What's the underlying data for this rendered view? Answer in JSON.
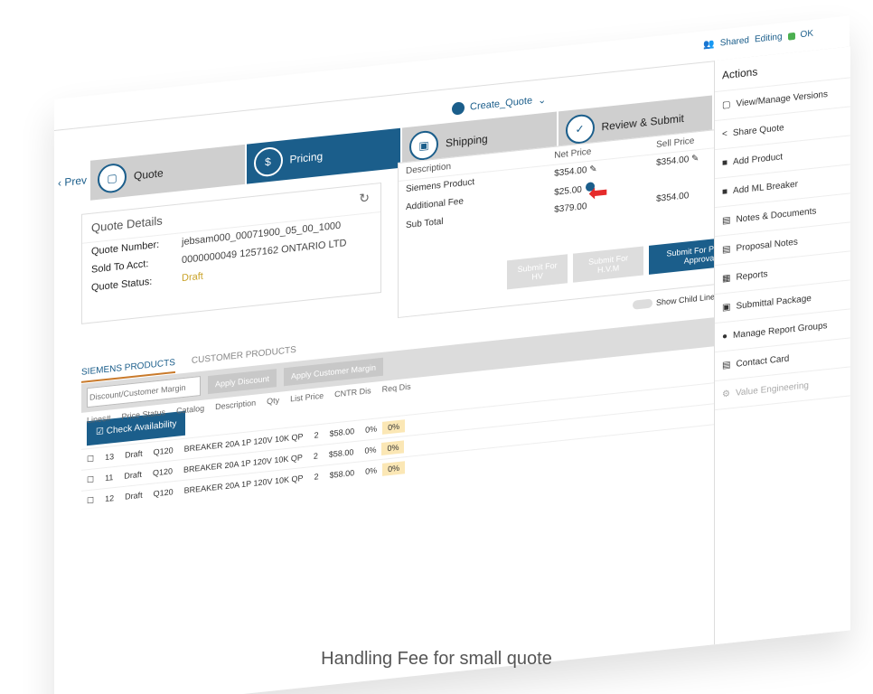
{
  "topbar": {
    "mode": "Shared",
    "editing": "Editing",
    "status_badge": "OK"
  },
  "quote_chip": "Create_Quote",
  "stepper": [
    {
      "label": "Quote",
      "icon": "document-icon"
    },
    {
      "label": "Pricing",
      "icon": "dollar-icon"
    },
    {
      "label": "Shipping",
      "icon": "box-icon"
    },
    {
      "label": "Review & Submit",
      "icon": "check-icon"
    }
  ],
  "prev": "Prev",
  "quote_details": {
    "title": "Quote Details",
    "quote_number_label": "Quote Number:",
    "quote_number": "jebsam000_00071900_05_00_1000",
    "sold_to_label": "Sold To Acct:",
    "sold_to": "0000000049 1257162 ONTARIO LTD",
    "status_label": "Quote Status:",
    "status": "Draft"
  },
  "pricing_summary": {
    "headers": [
      "Description",
      "Net Price",
      "Sell Price"
    ],
    "rows": [
      {
        "desc": "Siemens Product",
        "net": "$354.00",
        "sell": "$354.00"
      },
      {
        "desc": "Additional Fee",
        "net": "$25.00",
        "sell": ""
      },
      {
        "desc": "Sub Total",
        "net": "$379.00",
        "sell": "$354.00"
      }
    ],
    "buttons": [
      "Submit For HV",
      "Submit For H.V.M",
      "Submit For Pricing Approval"
    ]
  },
  "tabs": [
    "SIEMENS PRODUCTS",
    "CUSTOMER PRODUCTS"
  ],
  "show_child_lines": "Show Child Lines",
  "toolbar": {
    "input_placeholder": "Discount/Customer Margin",
    "apply_discount": "Apply Discount",
    "apply_margin": "Apply Customer Margin"
  },
  "check_availability": "Check Availability",
  "grid": {
    "headers": [
      "Lines#",
      "Price Status",
      "Catalog",
      "Description",
      "Qty",
      "List Price",
      "CNTR Dis",
      "Req Dis"
    ],
    "filter_all": "All",
    "rows": [
      {
        "line": "13",
        "status": "Draft",
        "catalog": "Q120",
        "desc": "BREAKER 20A 1P 120V 10K QP",
        "qty": "2",
        "price": "$58.00",
        "cntr": "0%",
        "req": "0%"
      },
      {
        "line": "11",
        "status": "Draft",
        "catalog": "Q120",
        "desc": "BREAKER 20A 1P 120V 10K QP",
        "qty": "2",
        "price": "$58.00",
        "cntr": "0%",
        "req": "0%"
      },
      {
        "line": "12",
        "status": "Draft",
        "catalog": "Q120",
        "desc": "BREAKER 20A 1P 120V 10K QP",
        "qty": "2",
        "price": "$58.00",
        "cntr": "0%",
        "req": "0%"
      }
    ]
  },
  "actions": {
    "title": "Actions",
    "items": [
      "View/Manage Versions",
      "Share Quote",
      "Add Product",
      "Add ML Breaker",
      "Notes & Documents",
      "Proposal Notes",
      "Reports",
      "Submittal Package",
      "Manage Report Groups",
      "Contact Card",
      "Value Engineering"
    ]
  },
  "caption": "Handling Fee for small quote"
}
